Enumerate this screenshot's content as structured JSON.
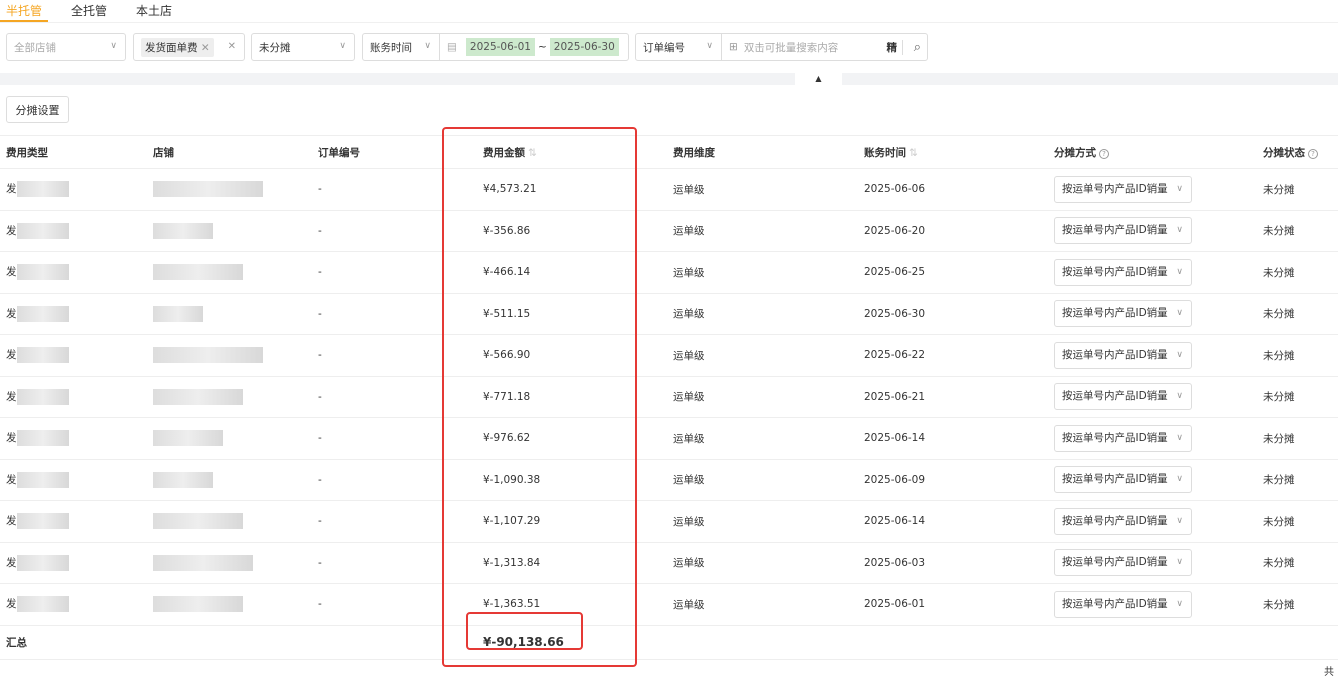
{
  "tabs": [
    {
      "label": "半托管",
      "active": true
    },
    {
      "label": "全托管"
    },
    {
      "label": "本土店"
    }
  ],
  "filters": {
    "shop_placeholder": "全部店铺",
    "fee_type_chip": "发货面单费",
    "status": "未分摊",
    "time_type": "账务时间",
    "date_start": "2025-06-01",
    "date_sep": "~",
    "date_end": "2025-06-30",
    "search_field": "订单编号",
    "search_placeholder": "双击可批量搜索内容",
    "exact_label": "精"
  },
  "toolbar": {
    "allocation_settings": "分摊设置"
  },
  "table": {
    "headers": [
      "费用类型",
      "店铺",
      "订单编号",
      "费用金额",
      "费用维度",
      "账务时间",
      "分摊方式",
      "分摊状态"
    ],
    "rows": [
      {
        "type": "发",
        "order": "-",
        "amount": "¥4,573.21",
        "dim": "运单级",
        "date": "2025-06-06",
        "method": "按运单号内产品ID销量",
        "status": "未分摊"
      },
      {
        "type": "发",
        "order": "-",
        "amount": "¥-356.86",
        "dim": "运单级",
        "date": "2025-06-20",
        "method": "按运单号内产品ID销量",
        "status": "未分摊"
      },
      {
        "type": "发",
        "order": "-",
        "amount": "¥-466.14",
        "dim": "运单级",
        "date": "2025-06-25",
        "method": "按运单号内产品ID销量",
        "status": "未分摊"
      },
      {
        "type": "发",
        "order": "-",
        "amount": "¥-511.15",
        "dim": "运单级",
        "date": "2025-06-30",
        "method": "按运单号内产品ID销量",
        "status": "未分摊"
      },
      {
        "type": "发",
        "order": "-",
        "amount": "¥-566.90",
        "dim": "运单级",
        "date": "2025-06-22",
        "method": "按运单号内产品ID销量",
        "status": "未分摊"
      },
      {
        "type": "发",
        "order": "-",
        "amount": "¥-771.18",
        "dim": "运单级",
        "date": "2025-06-21",
        "method": "按运单号内产品ID销量",
        "status": "未分摊"
      },
      {
        "type": "发",
        "order": "-",
        "amount": "¥-976.62",
        "dim": "运单级",
        "date": "2025-06-14",
        "method": "按运单号内产品ID销量",
        "status": "未分摊"
      },
      {
        "type": "发",
        "order": "-",
        "amount": "¥-1,090.38",
        "dim": "运单级",
        "date": "2025-06-09",
        "method": "按运单号内产品ID销量",
        "status": "未分摊"
      },
      {
        "type": "发",
        "order": "-",
        "amount": "¥-1,107.29",
        "dim": "运单级",
        "date": "2025-06-14",
        "method": "按运单号内产品ID销量",
        "status": "未分摊"
      },
      {
        "type": "发",
        "order": "-",
        "amount": "¥-1,313.84",
        "dim": "运单级",
        "date": "2025-06-03",
        "method": "按运单号内产品ID销量",
        "status": "未分摊"
      },
      {
        "type": "发",
        "order": "-",
        "amount": "¥-1,363.51",
        "dim": "运单级",
        "date": "2025-06-01",
        "method": "按运单号内产品ID销量",
        "status": "未分摊"
      }
    ],
    "total_label": "汇总",
    "total_amount": "¥-90,138.66"
  },
  "footer": {
    "total_prefix": "共"
  },
  "colors": {
    "accent": "#f5a623",
    "highlight": "#e53935",
    "date_bg": "#cde9cd"
  }
}
